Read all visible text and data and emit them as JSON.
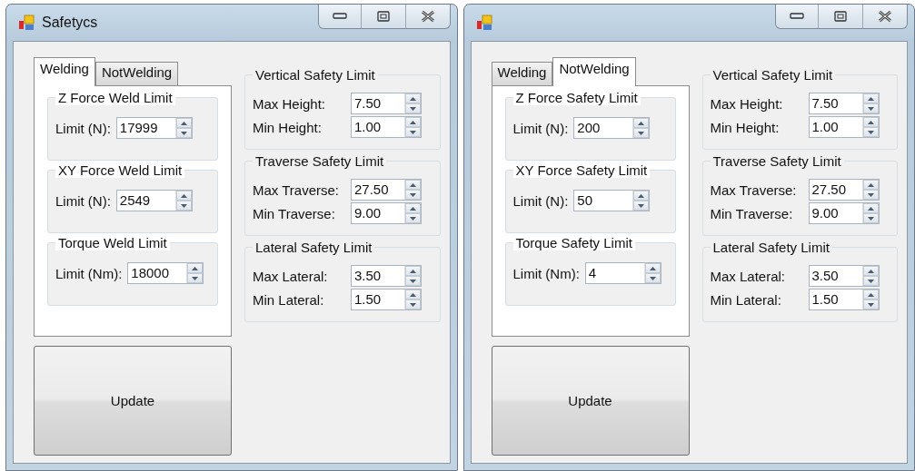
{
  "windows": [
    {
      "title": "Safetycs",
      "tabs": [
        {
          "label": "Welding",
          "selected": true
        },
        {
          "label": "NotWelding",
          "selected": false
        }
      ],
      "tab_groups": [
        {
          "title": "Z Force Weld Limit",
          "fields": [
            {
              "label": "Limit (N):",
              "value": "17999"
            }
          ]
        },
        {
          "title": "XY Force Weld Limit",
          "fields": [
            {
              "label": "Limit (N):",
              "value": "2549"
            }
          ]
        },
        {
          "title": "Torque Weld Limit",
          "fields": [
            {
              "label": "Limit (Nm):",
              "value": "18000"
            }
          ]
        }
      ],
      "side_groups": [
        {
          "title": "Vertical Safety Limit",
          "fields": [
            {
              "label": "Max Height:",
              "value": "7.50"
            },
            {
              "label": "Min Height:",
              "value": "1.00"
            }
          ]
        },
        {
          "title": "Traverse Safety Limit",
          "fields": [
            {
              "label": "Max Traverse:",
              "value": "27.50"
            },
            {
              "label": "Min Traverse:",
              "value": "9.00"
            }
          ]
        },
        {
          "title": "Lateral Safety Limit",
          "fields": [
            {
              "label": "Max Lateral:",
              "value": "3.50"
            },
            {
              "label": "Min Lateral:",
              "value": "1.50"
            }
          ]
        }
      ],
      "button": "Update"
    },
    {
      "tabs": [
        {
          "label": "Welding",
          "selected": false
        },
        {
          "label": "NotWelding",
          "selected": true
        }
      ],
      "tab_groups": [
        {
          "title": "Z Force Safety Limit",
          "fields": [
            {
              "label": "Limit (N):",
              "value": "200"
            }
          ]
        },
        {
          "title": "XY Force Safety Limit",
          "fields": [
            {
              "label": "Limit (N):",
              "value": "50"
            }
          ]
        },
        {
          "title": "Torque Safety Limit",
          "fields": [
            {
              "label": "Limit (Nm):",
              "value": "4"
            }
          ]
        }
      ],
      "side_groups": [
        {
          "title": "Vertical Safety Limit",
          "fields": [
            {
              "label": "Max Height:",
              "value": "7.50"
            },
            {
              "label": "Min Height:",
              "value": "1.00"
            }
          ]
        },
        {
          "title": "Traverse Safety Limit",
          "fields": [
            {
              "label": "Max Traverse:",
              "value": "27.50"
            },
            {
              "label": "Min Traverse:",
              "value": "9.00"
            }
          ]
        },
        {
          "title": "Lateral Safety Limit",
          "fields": [
            {
              "label": "Max Lateral:",
              "value": "3.50"
            },
            {
              "label": "Min Lateral:",
              "value": "1.50"
            }
          ]
        }
      ],
      "button": "Update"
    }
  ]
}
